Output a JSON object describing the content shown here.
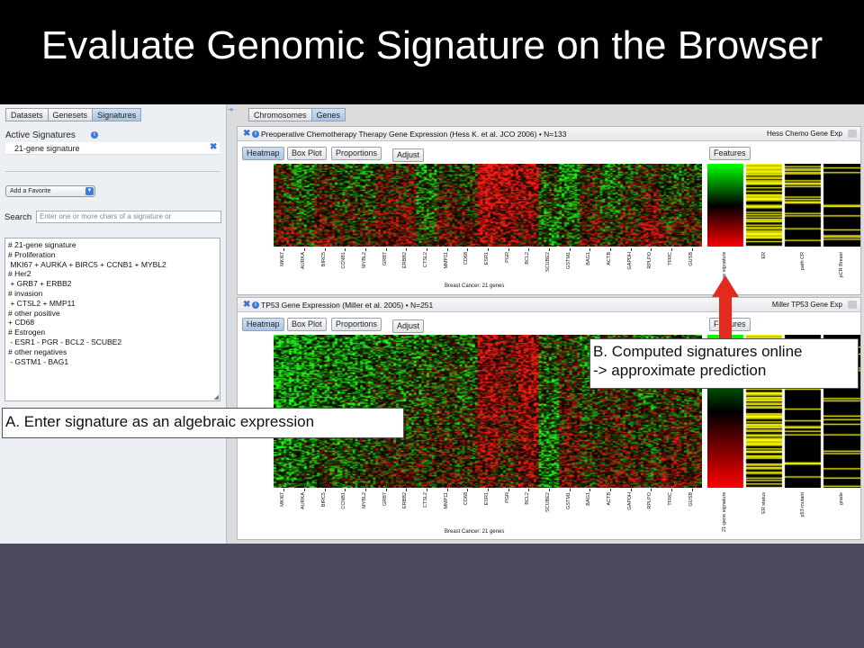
{
  "slide": {
    "title": "Evaluate Genomic Signature on the Browser"
  },
  "left_panel": {
    "tabs": [
      {
        "label": "Datasets",
        "active": false
      },
      {
        "label": "Genesets",
        "active": false
      },
      {
        "label": "Signatures",
        "active": true
      }
    ],
    "active_signatures_label": "Active Signatures",
    "active_signature": "21-gene signature",
    "favorite_select": "Add a Favorite",
    "search_label": "Search",
    "search_placeholder": "Enter one or more chars of a signature or",
    "expression_lines": [
      "# 21-gene signature",
      "# Proliferation",
      " MKI67 + AURKA + BIRC5 + CCNB1 + MYBL2",
      "# Her2",
      " + GRB7 + ERBB2",
      "# invasion",
      " + CTSL2 + MMP11",
      "# other positive",
      "+ CD68",
      "# Estrogen",
      " - ESR1 - PGR - BCL2 - SCUBE2",
      "# other negatives",
      " - GSTM1 - BAG1"
    ]
  },
  "right_panel": {
    "tabs": [
      {
        "label": "Chromosomes",
        "active": false
      },
      {
        "label": "Genes",
        "active": true
      }
    ]
  },
  "view_buttons": [
    "Heatmap",
    "Box Plot",
    "Proportions"
  ],
  "adjust_label": "Adjust",
  "features_label": "Features",
  "genes": [
    "MKI67",
    "AURKA",
    "BIRC5",
    "CCNB1",
    "MYBL2",
    "GRB7",
    "ERBB2",
    "CTSL2",
    "MMP11",
    "CD68",
    "ESR1",
    "PGR",
    "BCL2",
    "SCUBE2",
    "GSTM1",
    "BAG1",
    "ACTB",
    "GAPDH",
    "RPLPO",
    "TFRC",
    "GUSB"
  ],
  "x_caption": "Breast Cancer: 21 genes",
  "panels": [
    {
      "title": "Preoperative Chemotherapy Therapy Gene Expression (Hess K. et al. JCO 2006) • N=133",
      "dataset": "Hess Chemo Gene Exp",
      "features": [
        "21-gene signature",
        "ER",
        "path CR",
        "pCR Breast"
      ]
    },
    {
      "title": "TP53 Gene Expression (Miller et al. 2005) • N=251",
      "dataset": "Miller TP53 Gene Exp",
      "features": [
        "21-gene signature",
        "ER status",
        "p53 mutant",
        "grade"
      ]
    }
  ],
  "callouts": {
    "a": "A. Enter signature as an algebraic expression",
    "b_line1": "B. Computed signatures online",
    "b_line2": "-> approximate prediction"
  },
  "colors": {
    "heat_high": "#ff2a1a",
    "heat_low": "#22ee22",
    "heat_mid": "#000000",
    "feature_yellow": "#ffff00",
    "arrow": "#e4291f",
    "accent": "#3d7ad6"
  }
}
